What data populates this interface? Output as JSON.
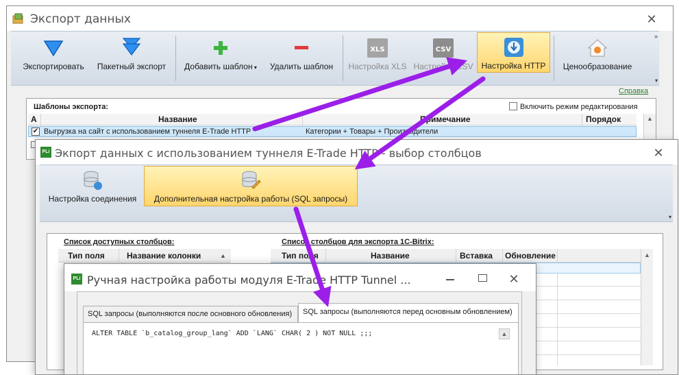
{
  "win1": {
    "title": "Экспорт данных",
    "toolbar": {
      "export": "Экспортировать",
      "batch_export": "Пакетный экспорт",
      "add_template": "Добавить шаблон",
      "remove_template": "Удалить шаблон",
      "xls_settings": "Настройка XLS",
      "csv_settings": "Настройка CSV",
      "http_settings": "Настройка HTTP",
      "pricing": "Ценообразование",
      "xls_icon_text": "XLS",
      "csv_icon_text": "CSV"
    },
    "help_link": "Справка",
    "templates_title": "Шаблоны экспорта:",
    "edit_mode_label": "Включить режим редактирования",
    "columns": {
      "active": "А",
      "name": "Название",
      "note": "Примечание",
      "order": "Порядок"
    },
    "rows": [
      {
        "name": "Выгрузка на сайт с использованием туннеля E-Trade HTTP",
        "note": "Категории + Товары + Производители",
        "checked": true
      }
    ]
  },
  "win2": {
    "title": "Экпорт данных с использованием туннеля E-Trade HTTP - выбор столбцов",
    "app_icon": "PLi",
    "toolbar": {
      "connection": "Настройка соединения",
      "advanced": "Дополнительная настройка работы (SQL запросы)"
    },
    "available_title": "Список доступных столбцов:",
    "available_columns": {
      "field_type": "Тип поля",
      "column_name": "Название колонки"
    },
    "export_title": "Список столбцов для экспорта 1С-Bitrix:",
    "export_columns": {
      "field_type": "Тип поля",
      "name": "Название",
      "insert": "Вставка",
      "update": "Обновление"
    }
  },
  "win3": {
    "title": "Ручная настройка работы модуля E-Trade HTTP Tunnel ...",
    "app_icon": "PLi",
    "tabs": [
      "SQL запросы (выполняются после основного обновления)",
      "SQL запросы (выполняются перед основным обновлением)"
    ],
    "sql_text": "ALTER TABLE `b_catalog_group_lang` ADD `LANG` CHAR( 2 ) NOT NULL ;;;"
  },
  "colors": {
    "accent_arrow": "#9b1fe8",
    "highlight_button": "#ffd66e",
    "selected_row": "#cfe8fb",
    "help_link": "#2f7d32"
  }
}
